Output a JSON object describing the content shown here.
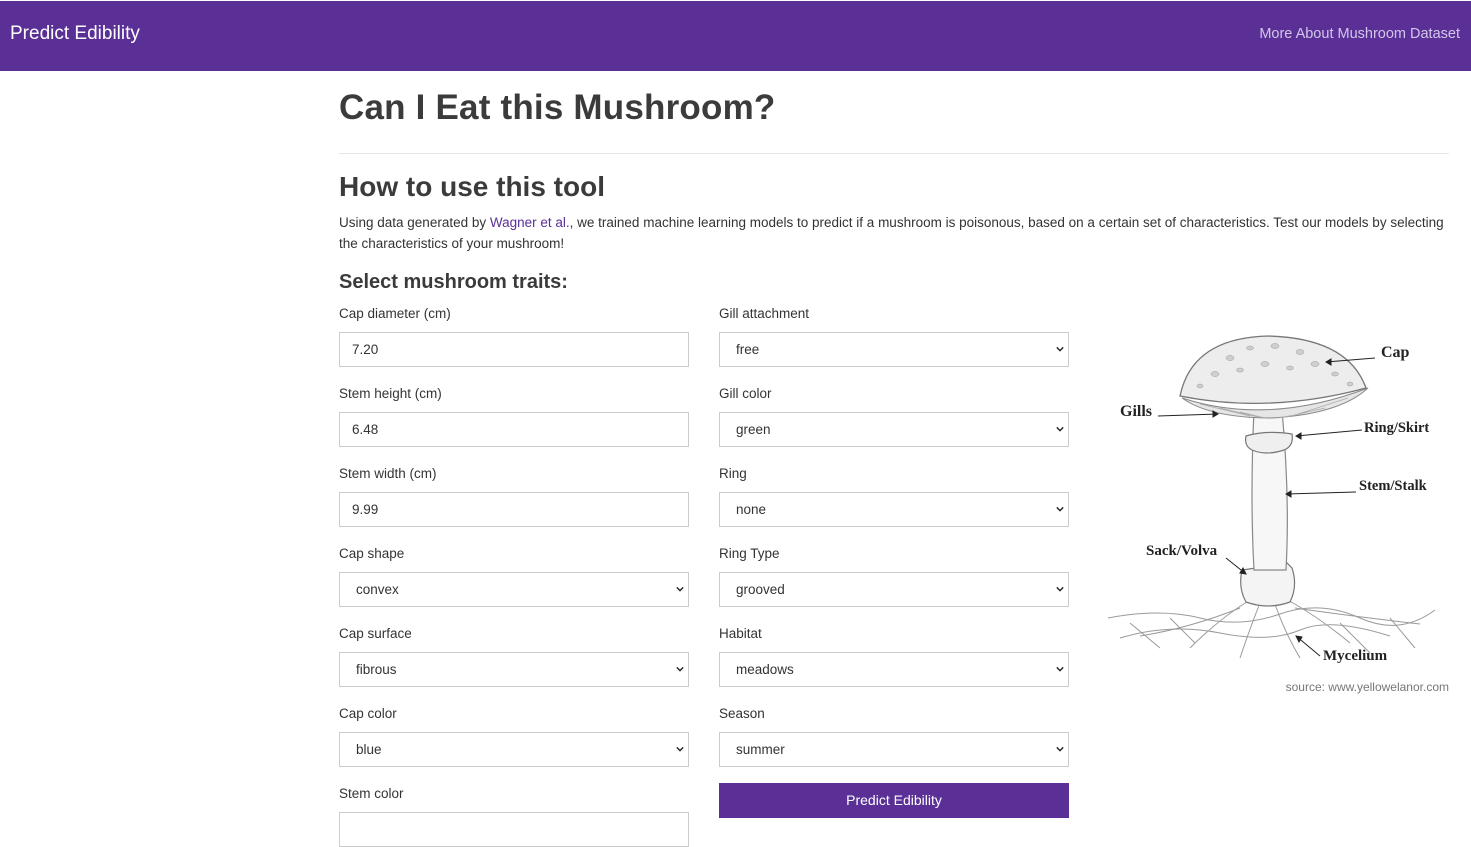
{
  "nav": {
    "brand": "Predict Edibility",
    "link": "More About Mushroom Dataset"
  },
  "header": {
    "title": "Can I Eat this Mushroom?"
  },
  "howto": {
    "title": "How to use this tool",
    "text_before": "Using data generated by ",
    "link_text": "Wagner et al.",
    "text_after": ", we trained machine learning models to predict if a mushroom is poisonous, based on a certain set of characteristics. Test our models by selecting the characteristics of your mushroom!"
  },
  "form": {
    "title": "Select mushroom traits:",
    "cap_diameter": {
      "label": "Cap diameter (cm)",
      "value": "7.20"
    },
    "stem_height": {
      "label": "Stem height (cm)",
      "value": "6.48"
    },
    "stem_width": {
      "label": "Stem width (cm)",
      "value": "9.99"
    },
    "cap_shape": {
      "label": "Cap shape",
      "value": "convex"
    },
    "cap_surface": {
      "label": "Cap surface",
      "value": "fibrous"
    },
    "cap_color": {
      "label": "Cap color",
      "value": "blue"
    },
    "stem_color": {
      "label": "Stem color",
      "value": ""
    },
    "gill_attachment": {
      "label": "Gill attachment",
      "value": "free"
    },
    "gill_color": {
      "label": "Gill color",
      "value": "green"
    },
    "ring": {
      "label": "Ring",
      "value": "none"
    },
    "ring_type": {
      "label": "Ring Type",
      "value": "grooved"
    },
    "habitat": {
      "label": "Habitat",
      "value": "meadows"
    },
    "season": {
      "label": "Season",
      "value": "summer"
    },
    "submit_label": "Predict Edibility"
  },
  "diagram": {
    "labels": {
      "cap": "Cap",
      "gills": "Gills",
      "ring": "Ring/Skirt",
      "stem": "Stem/Stalk",
      "volva": "Sack/Volva",
      "mycelium": "Mycelium"
    },
    "source": "source: www.yellowelanor.com"
  },
  "colors": {
    "brand": "#5a3096",
    "nav_link": "#d4c6ea"
  },
  "icons": {
    "select_arrow": "chevron-down-icon"
  }
}
